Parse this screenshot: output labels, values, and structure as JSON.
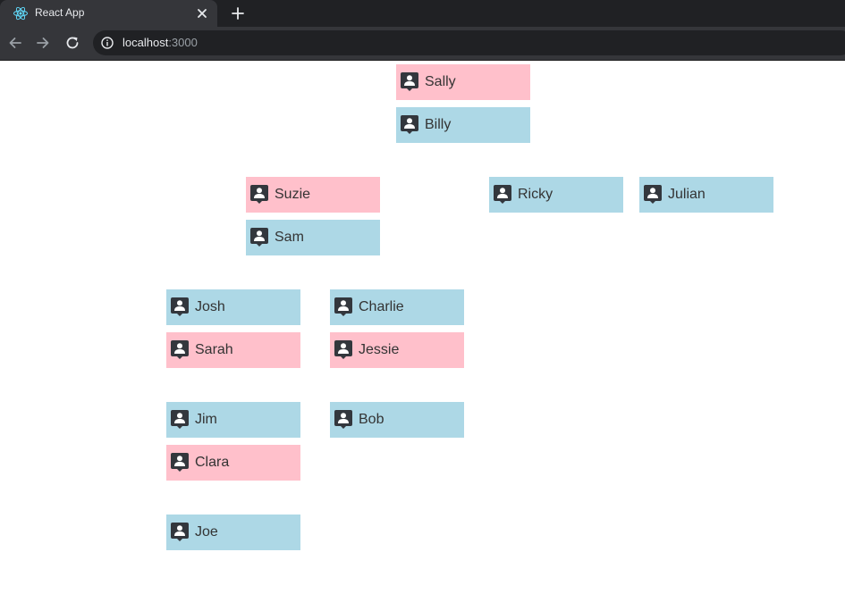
{
  "browser": {
    "tab_title": "React App",
    "url_host": "localhost",
    "url_port": ":3000"
  },
  "colors": {
    "male": "#add8e6",
    "female": "#ffc0cb"
  },
  "icons": {
    "card": "person-badge-icon",
    "tab": "react-icon"
  },
  "family": {
    "sally": "Sally",
    "billy": "Billy",
    "suzie": "Suzie",
    "sam": "Sam",
    "ricky": "Ricky",
    "julian": "Julian",
    "josh": "Josh",
    "sarah": "Sarah",
    "charlie": "Charlie",
    "jessie": "Jessie",
    "jim": "Jim",
    "clara": "Clara",
    "bob": "Bob",
    "joe": "Joe"
  }
}
